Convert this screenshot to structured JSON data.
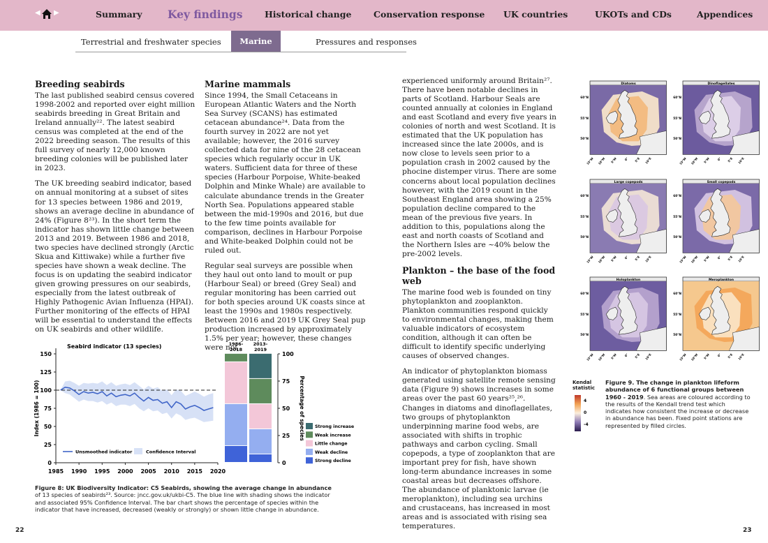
{
  "nav": {
    "items": [
      "Summary",
      "Key findings",
      "Historical change",
      "Conservation response",
      "UK countries",
      "UKOTs and CDs",
      "Appendices"
    ],
    "active": "Key findings"
  },
  "subnav": {
    "items": [
      "Terrestrial and freshwater species",
      "Marine",
      "Pressures and responses"
    ],
    "active": "Marine"
  },
  "col1": {
    "heading": "Breeding seabirds",
    "p1": "The last published seabird census covered 1998-2002 and reported over eight million seabirds breeding in Great Britain and Ireland annually²². The latest seabird census was completed at the end of the 2022 breeding season. The results of this full survey of nearly 12,000 known breeding colonies will be published later in 2023.",
    "p2": "The UK breeding seabird indicator, based on annual monitoring at a subset of sites for 13 species between 1986 and 2019, shows an average decline in abundance of 24% (Figure 8²³). In the short term the indicator has shown little change between 2013 and 2019. Between 1986 and 2018, two species have declined strongly (Arctic Skua and Kittiwake) while a further five species have shown a weak decline. The focus is on updating the seabird indicator given growing pressures on our seabirds, especially from the latest outbreak of Highly Pathogenic Avian Influenza (HPAI). Further monitoring of the effects of HPAI will be essential to understand the effects on UK seabirds and other wildlife."
  },
  "col2": {
    "heading": "Marine mammals",
    "p1": "Since 1994, the Small Cetaceans in European Atlantic Waters and the North Sea Survey (SCANS) has estimated cetacean abundance²⁴. Data from the fourth survey in 2022 are not yet available; however, the 2016 survey collected data for nine of the 28 cetacean species which regularly occur in UK waters. Sufficient data for three of these species (Harbour Porpoise, White-beaked Dolphin and Minke Whale) are available to calculate abundance trends in the Greater North Sea. Populations appeared stable between the mid-1990s and 2016, but due to the few time points available for comparison, declines in Harbour Porpoise and White-beaked Dolphin could not be ruled out.",
    "p2": "Regular seal surveys are possible when they haul out onto land to moult or pup (Harbour Seal) or breed (Grey Seal) and regular monitoring has been carried out for both species around UK coasts since at least the 1990s and 1980s respectively. Between 2016 and 2019 UK Grey Seal pup production increased by approximately 1.5% per year; however, these changes were not"
  },
  "col3": {
    "p0": "experienced uniformly around Britain²⁷. There have been notable declines in parts of Scotland. Harbour Seals are counted annually at colonies in England and east Scotland and every five years in colonies of north and west Scotland. It is estimated that the UK population has increased since the late 2000s, and is now close to levels seen prior to a population crash in 2002 caused by the phocine distemper virus. There are some concerns about local population declines however, with the 2019 count in the Southeast England area showing a 25% population decline compared to the mean of the previous five years. In addition to this, populations along the east and north coasts of Scotland and the Northern Isles are ~40% below the pre-2002 levels.",
    "heading": "Plankton – the base of the food web",
    "p1": "The marine food web is founded on tiny phytoplankton and zooplankton. Plankton communities respond quickly to environmental changes, making them valuable indicators of ecosystem condition, although it can often be difficult to identify specific underlying causes of observed changes.",
    "p2": "An indicator of phytoplankton biomass generated using satellite remote sensing data (Figure 9) shows increases in some areas over the past 60 years²⁵,²⁶. Changes in diatoms and dinoflagellates, two groups of phytoplankton underpinning marine food webs, are associated with shifts in trophic pathways and carbon cycling. Small copepods, a type of zooplankton that are important prey for fish, have shown long-term abundance increases in some coastal areas but decreases offshore. The abundance of planktonic larvae (ie meroplankton), including sea urchins and crustaceans, has increased in most areas and is associated with rising sea temperatures."
  },
  "fig8": {
    "caption_bold": "Figure 8: UK Biodiversity Indicator: C5 Seabirds, showing the average change in abundance",
    "caption_rest": " of 13 species of seabirds²³. Source: jncc.gov.uk/ukbi-C5. The blue line with shading shows the indicator and associated 95% Confidence Interval. The bar chart shows the percentage of species within the indicator that have increased, decreased (weakly or strongly) or shown little change in abundance."
  },
  "fig9": {
    "caption_bold": "Figure 9. The change in plankton lifeform abundance of 6 functional groups between 1960 - 2019",
    "caption_rest": ". Sea areas are coloured according to the results of the Kendall trend test which indicates how consistent the increase or decrease in abundance has been. Fixed point stations are represented by filled circles.",
    "panels": [
      "Diatoms",
      "Dinoflagellates",
      "Large copepods",
      "Small copepods",
      "Holoplankton",
      "Meroplankton"
    ],
    "lat_labels": [
      "60°N",
      "55°N",
      "50°N"
    ],
    "lon_labels": [
      "15°W",
      "10°W",
      "5°W",
      "0°",
      "5°E",
      "10°E"
    ],
    "legend_title": "Kendal statistic",
    "legend_ticks": [
      "4",
      "0",
      "-4"
    ]
  },
  "pages": {
    "left": "22",
    "right": "23"
  },
  "chart_data": [
    {
      "type": "line",
      "title": "Seabird indicator (13 species)",
      "ylabel": "Index (1986 = 100)",
      "xlabel": "",
      "ylim": [
        0,
        150
      ],
      "xlim": [
        1985,
        2020
      ],
      "x_ticks": [
        1985,
        1990,
        1995,
        2000,
        2005,
        2010,
        2015,
        2020
      ],
      "y_ticks": [
        0,
        25,
        50,
        75,
        100,
        125,
        150
      ],
      "baseline": 100,
      "series": [
        {
          "name": "Unsmoothed indicator",
          "x": [
            1986,
            1987,
            1988,
            1989,
            1990,
            1991,
            1992,
            1993,
            1994,
            1995,
            1996,
            1997,
            1998,
            1999,
            2000,
            2001,
            2002,
            2003,
            2004,
            2005,
            2006,
            2007,
            2008,
            2009,
            2010,
            2011,
            2012,
            2013,
            2014,
            2015,
            2016,
            2017,
            2018,
            2019
          ],
          "y": [
            100,
            104,
            103,
            99,
            94,
            98,
            96,
            97,
            95,
            98,
            92,
            96,
            91,
            93,
            94,
            92,
            96,
            90,
            85,
            90,
            86,
            87,
            82,
            84,
            76,
            84,
            81,
            74,
            77,
            79,
            76,
            72,
            74,
            76
          ],
          "lower": [
            100,
            96,
            94,
            89,
            84,
            87,
            85,
            85,
            83,
            85,
            80,
            83,
            78,
            80,
            80,
            78,
            81,
            75,
            71,
            75,
            71,
            72,
            67,
            69,
            61,
            68,
            65,
            59,
            61,
            62,
            59,
            56,
            57,
            58
          ],
          "upper": [
            100,
            112,
            113,
            110,
            106,
            110,
            109,
            110,
            109,
            112,
            107,
            111,
            106,
            108,
            109,
            107,
            111,
            106,
            101,
            106,
            102,
            104,
            99,
            101,
            93,
            101,
            99,
            92,
            95,
            98,
            95,
            91,
            94,
            96
          ]
        }
      ],
      "ci_label": "Confidence Interval"
    },
    {
      "type": "bar",
      "ylabel": "Percentage of species",
      "ylim": [
        0,
        100
      ],
      "y_ticks": [
        0,
        25,
        50,
        75,
        100
      ],
      "categories": [
        "1986-2018",
        "2013-2019"
      ],
      "series": [
        {
          "name": "Strong decline",
          "values": [
            15.4,
            7.7
          ],
          "color": "#3f63d8"
        },
        {
          "name": "Weak decline",
          "values": [
            38.5,
            23.1
          ],
          "color": "#94aef0"
        },
        {
          "name": "Little change",
          "values": [
            38.5,
            23.1
          ],
          "color": "#f3c7d8"
        },
        {
          "name": "Weak increase",
          "values": [
            7.7,
            23.1
          ],
          "color": "#5e8b5c"
        },
        {
          "name": "Strong increase",
          "values": [
            0,
            23.1
          ],
          "color": "#3b6c70"
        }
      ]
    }
  ]
}
